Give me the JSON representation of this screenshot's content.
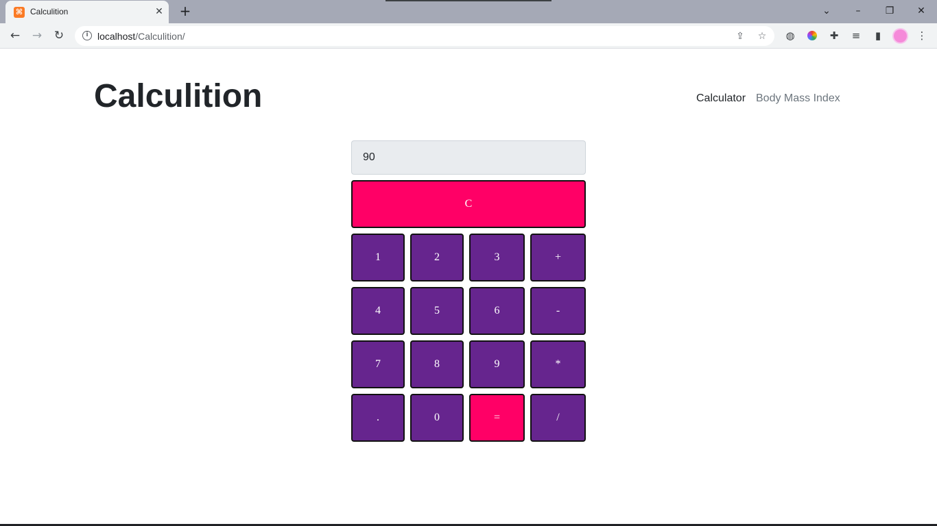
{
  "browser": {
    "tab_title": "Calculition",
    "favicon_glyph": "⌘",
    "url_host": "localhost",
    "url_path": "/Calculition/",
    "icons": {
      "back": "back-arrow-icon",
      "forward": "forward-arrow-icon",
      "reload": "reload-icon",
      "info": "info-icon",
      "share": "share-icon",
      "bookmark": "star-icon",
      "extensions": "puzzle-icon",
      "media": "media-queue-icon",
      "sidepanel": "side-panel-icon",
      "menu": "kebab-menu-icon"
    }
  },
  "header": {
    "title": "Calculition",
    "nav": [
      {
        "label": "Calculator",
        "active": true
      },
      {
        "label": "Body Mass Index",
        "active": false
      }
    ]
  },
  "calculator": {
    "display_value": "90",
    "clear_label": "C",
    "keys": [
      [
        "1",
        "2",
        "3",
        "+"
      ],
      [
        "4",
        "5",
        "6",
        "-"
      ],
      [
        "7",
        "8",
        "9",
        "*"
      ],
      [
        ".",
        "0",
        "=",
        "/"
      ]
    ],
    "colors": {
      "key": "#66258e",
      "accent": "#ff0066",
      "display_bg": "#e9ecef"
    }
  }
}
